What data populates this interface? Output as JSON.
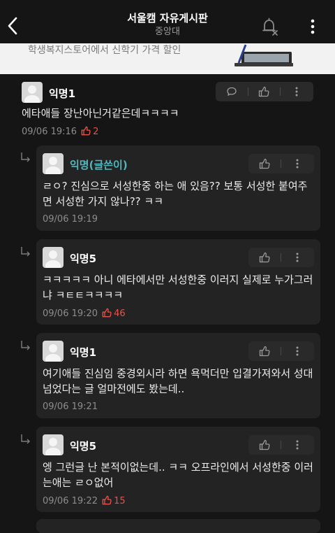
{
  "header": {
    "title": "서울캠 자유게시판",
    "subtitle": "중앙대"
  },
  "banner": {
    "text": "학생복지스토어에서 신학기 가격 할인"
  },
  "comment": {
    "author": "익명1",
    "text": "에타애들 장난아닌거같은데ㅋㅋㅋㅋ",
    "date": "09/06 19:16",
    "likes": "2"
  },
  "replies": [
    {
      "author": "익명(글쓴이)",
      "text": "ㄹㅇ? 진심으로 서성한중 하는 애 있음?? 보통 서성한 붙여주면 서성한 가지 않나?? ㅋㅋ",
      "date": "09/06 19:19",
      "likes": ""
    },
    {
      "author": "익명5",
      "text": "ㅋㅋㅋㅋㅋ 아니 에타에서만 서성한중 이러지 실제로 누가그러냐 ㅋㅌㅌㅋㅋㅋㅋ",
      "date": "09/06 19:20",
      "likes": "46"
    },
    {
      "author": "익명1",
      "text": "여기애들 진심임 중경외시라 하면 욕먹더만 입결가져와서 성대넘었다는 글 얼마전에도 봤는데..",
      "date": "09/06 19:21",
      "likes": ""
    },
    {
      "author": "익명5",
      "text": "엥 그런글 난 본적이없는데.. ㅋㅋ 오프라인에서 서성한중 이러는애는 ㄹㅇ없어",
      "date": "09/06 19:22",
      "likes": "15"
    }
  ]
}
